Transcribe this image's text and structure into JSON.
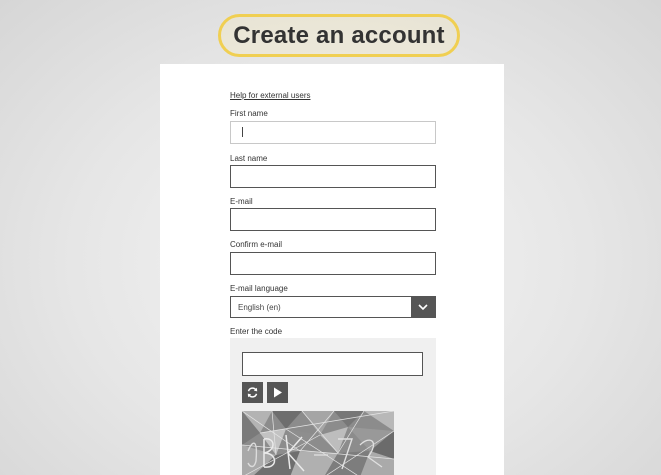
{
  "header": {
    "title": "Create an account"
  },
  "form": {
    "help_link": "Help for external users",
    "first_name": {
      "label": "First name",
      "value": ""
    },
    "last_name": {
      "label": "Last name",
      "value": ""
    },
    "email": {
      "label": "E-mail",
      "value": ""
    },
    "confirm_email": {
      "label": "Confirm e-mail",
      "value": ""
    },
    "email_language": {
      "label": "E-mail language",
      "selected": "English (en)"
    },
    "captcha": {
      "label": "Enter the code",
      "value": ""
    }
  },
  "icons": {
    "refresh": "refresh-icon",
    "play_audio": "play-icon",
    "dropdown": "chevron-down-icon"
  },
  "colors": {
    "highlight_border": "#f0cf52",
    "button_bg": "#555555",
    "card_bg": "#ffffff"
  }
}
